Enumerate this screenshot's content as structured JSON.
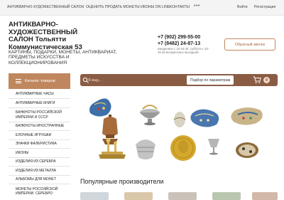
{
  "topbar": {
    "links": [
      "АНТИКВАРНО-ХУДОЖЕСТВЕННЫЙ САЛОН",
      "ОЦЕНИТЬ ПРОДАТЬ МОНЕТЫ ИКОНЫ ON LINE",
      "КОНТАКТЫ"
    ],
    "more": "•••",
    "login": "Войти",
    "register": "Регистрация"
  },
  "brand": {
    "line1": "АНТИКВАРНО-",
    "line2": "ХУДОЖЕСТВЕННЫЙ",
    "line3": "САЛОН Тольятти",
    "line4": "Коммунистическая 53"
  },
  "tagline": "КАРТИНЫ, ПОДАРКИ, МОНЕТЫ, АНТИКВАРИАТ, ПРЕДМЕТЫ ИСКУССТВА И КОЛЛЕКЦИОНИРОВАНИЯ",
  "contacts": {
    "phone1": "+7 (902) 299-55-00",
    "phone2": "+7 (8482) 24-87-13",
    "hours": "ежедневно с 10-18.30, суббота с 10-16.45 воскресенье выходной",
    "callback": "Обратный звонок"
  },
  "search": {
    "placeholder": "Я ищу...",
    "params_button": "Подбор по параметрам",
    "cart_count": "0"
  },
  "catalog": {
    "title": "Каталог товаров",
    "items": [
      "АНТИКВАРНЫЕ ЧАСЫ",
      "АНТИКВАРНЫЕ КНИГИ",
      "БАНКНОТЫ РОССИЙСКОЙ ИМПЕРИИ и СССР",
      "БАНКНОТЫ ИНОСТРАННЫЕ",
      "ЕЛОЧНЫЕ ИГРУШКИ",
      "ЗНАЧКИ ФАЛЕРИСТИКА",
      "ИКОНЫ",
      "ИЗДЕЛИЯ ИЗ СЕРЕБРА",
      "ИЗДЕЛИЯ ИЗ МЕТАЛЛА",
      "АЛЬБОМЫ ДЛЯ МОНЕТ",
      "МОНЕТЫ РОССИЙСКОЙ ИМПЕРИИ. СЕРЕБРО"
    ]
  },
  "popular_title": "Популярные производители",
  "colors": {
    "accent": "#c0875f",
    "searchbar": "#8a5c44",
    "topbar": "#f4f4f4"
  }
}
